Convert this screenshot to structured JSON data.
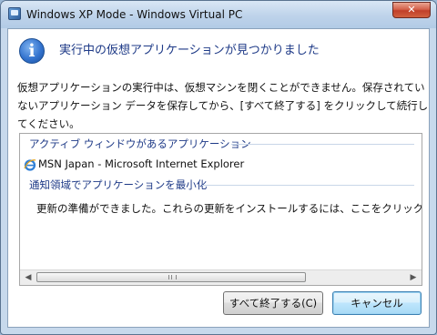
{
  "window": {
    "title": "Windows XP Mode - Windows Virtual PC",
    "close_glyph": "✕"
  },
  "dialog": {
    "icon": "info-icon",
    "icon_glyph": "i",
    "heading": "実行中の仮想アプリケーションが見つかりました",
    "message": "仮想アプリケーションの実行中は、仮想マシンを閉くことができません。保存されていないアプリケーション データを保存してから、[すべて終了する] をクリックして続行してください。"
  },
  "list": {
    "groups": [
      {
        "header": "アクティブ ウィンドウがあるアプリケーション",
        "items": [
          {
            "label": "MSN Japan - Microsoft Internet Explorer",
            "icon": "internet-explorer-icon"
          }
        ]
      },
      {
        "header": "通知領域でアプリケーションを最小化",
        "items": [
          {
            "label": "更新の準備ができました。これらの更新をインストールするには、ここをクリックしてくだ"
          }
        ]
      }
    ],
    "scroll": {
      "left_arrow": "◀",
      "right_arrow": "▶"
    }
  },
  "buttons": {
    "close_all": "すべて終了する(C)",
    "cancel": "キャンセル"
  }
}
